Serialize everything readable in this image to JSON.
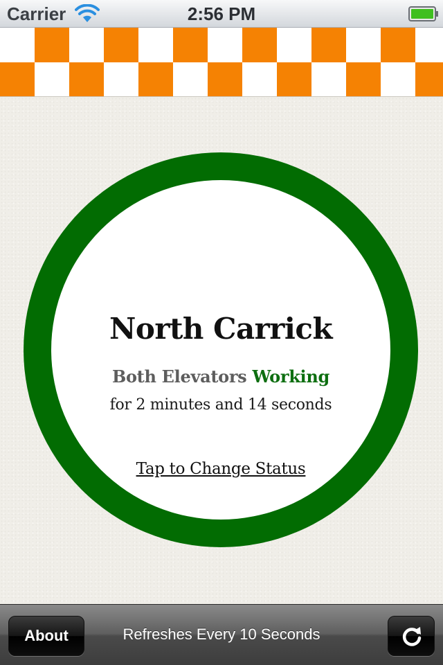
{
  "status_bar": {
    "carrier": "Carrier",
    "time": "2:56 PM",
    "wifi_icon": "wifi-icon",
    "battery_icon": "battery-full-icon",
    "battery_color": "#3fbf1f"
  },
  "banner": {
    "pattern": "checkerboard",
    "colors": [
      "#f58203",
      "#ffffff"
    ]
  },
  "status": {
    "station": "North Carrick",
    "prefix": "Both Elevators",
    "state": "Working",
    "duration": "for 2 minutes and 14 seconds",
    "action_label": "Tap to Change Status",
    "ring_color": "#026c02",
    "state_color": "#0d6e10"
  },
  "toolbar": {
    "about_label": "About",
    "refresh_note": "Refreshes Every 10 Seconds",
    "refresh_icon": "refresh-icon"
  }
}
